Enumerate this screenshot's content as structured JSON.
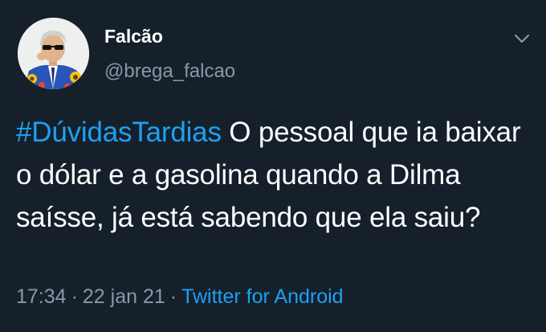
{
  "user": {
    "display_name": "Falcão",
    "handle": "@brega_falcao",
    "avatar_icon": "profile-photo"
  },
  "tweet": {
    "hashtag": "#DúvidasTardias",
    "text": " O pessoal que ia baixar o dólar e a gasolina quando a Dilma saísse, já está sabendo que ela saiu?"
  },
  "meta": {
    "time": "17:34",
    "separator": "·",
    "date": "22 jan 21",
    "source": "Twitter for Android"
  },
  "menu": {
    "icon": "chevron-down-icon"
  },
  "colors": {
    "background": "#15202b",
    "text": "#ffffff",
    "secondary": "#8899a6",
    "accent": "#1da1f2"
  }
}
